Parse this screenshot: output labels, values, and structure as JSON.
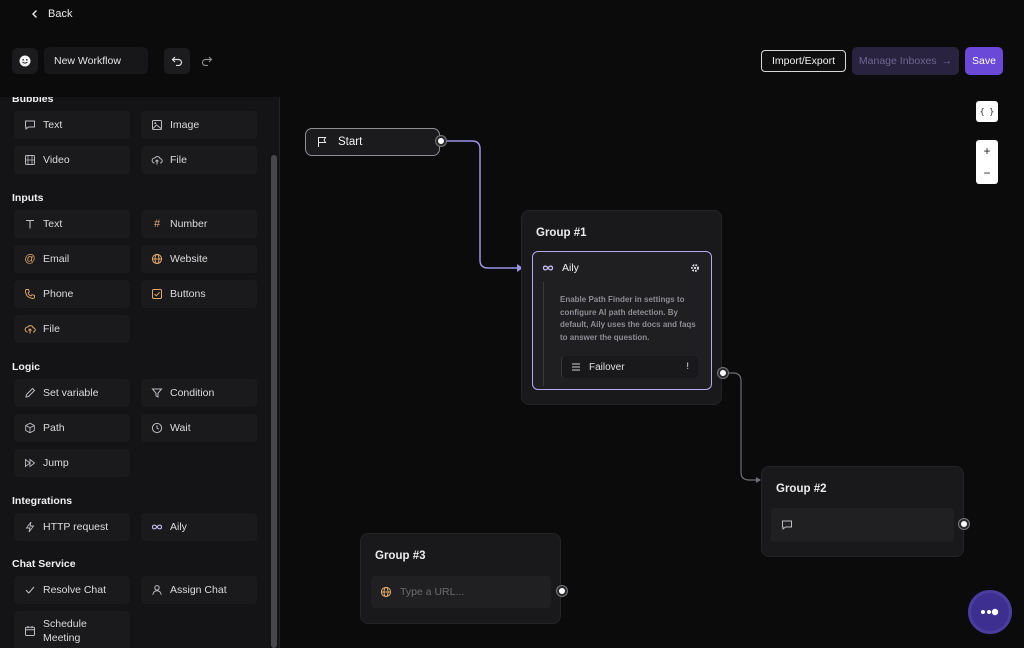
{
  "header": {
    "back_label": "Back",
    "workflow_name": "New Workflow",
    "import_export_label": "Import/Export",
    "manage_inboxes_label": "Manage Inboxes",
    "save_label": "Save"
  },
  "sidebar": {
    "sections": [
      {
        "title": "Bubbles",
        "items": [
          "Text",
          "Image",
          "Video",
          "File"
        ]
      },
      {
        "title": "Inputs",
        "items": [
          "Text",
          "Number",
          "Email",
          "Website",
          "Phone",
          "Buttons",
          "File"
        ]
      },
      {
        "title": "Logic",
        "items": [
          "Set variable",
          "Condition",
          "Path",
          "Wait",
          "Jump"
        ]
      },
      {
        "title": "Integrations",
        "items": [
          "HTTP request",
          "Aily"
        ]
      },
      {
        "title": "Chat Service",
        "items": [
          "Resolve Chat",
          "Assign Chat",
          "Schedule Meeting"
        ]
      }
    ]
  },
  "canvas": {
    "json_button_label": "{ }",
    "zoom_in_label": "+",
    "zoom_out_label": "−",
    "start_node_label": "Start",
    "group1": {
      "title": "Group #1",
      "aily_label": "Aily",
      "aily_description": "Enable Path Finder in settings to configure AI path detection. By default, Aily uses the docs and faqs to answer the question.",
      "failover_label": "Failover",
      "failover_badge": "!"
    },
    "group2": {
      "title": "Group #2"
    },
    "group3": {
      "title": "Group #3",
      "url_placeholder": "Type a URL..."
    }
  },
  "colors": {
    "accent": "#6a48d8",
    "selected_border": "#b6abf2",
    "background": "#0b0b0c"
  }
}
